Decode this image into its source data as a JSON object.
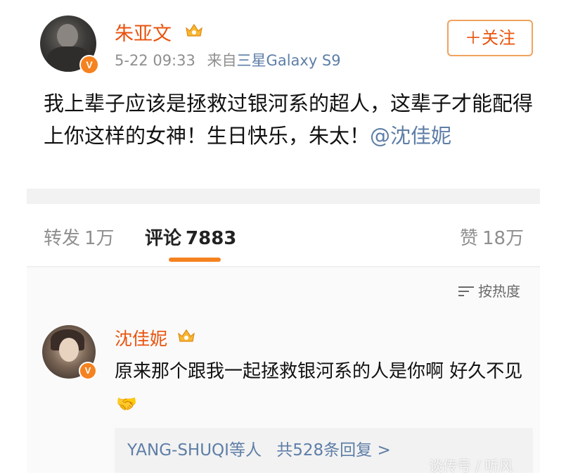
{
  "post": {
    "user_name": "朱亚文",
    "time": "5-22 09:33",
    "source_prefix": "来自",
    "device": "三星Galaxy S9",
    "follow_label": "＋关注",
    "text_main": "我上辈子应该是拯救过银河系的超人，这辈子才能配得上你这样的女神！生日快乐，朱太！",
    "mention": "@沈佳妮"
  },
  "stats": {
    "repost_label": "转发",
    "repost_count": "1万",
    "comments_label": "评论",
    "comments_count": "7883",
    "likes_label": "赞",
    "likes_count": "18万"
  },
  "sort_label": "按热度",
  "comment": {
    "user_name": "沈佳妮",
    "text": "原来那个跟我一起拯救银河系的人是你啊 好久不见",
    "replies_users": "YANG-SHUQI等人",
    "replies_total": "共528条回复 >"
  },
  "watermark": "谈传号 / 听风",
  "verified_badge": "V",
  "icons": [
    "verified-badge-icon",
    "crown-member-icon",
    "sort-icon",
    "handshake-emoji-icon"
  ],
  "colors": {
    "accent_orange": "#e8530e",
    "link_blue": "#5e7ea7",
    "tab_underline": "#f58220",
    "badge_orange": "#f58220"
  }
}
